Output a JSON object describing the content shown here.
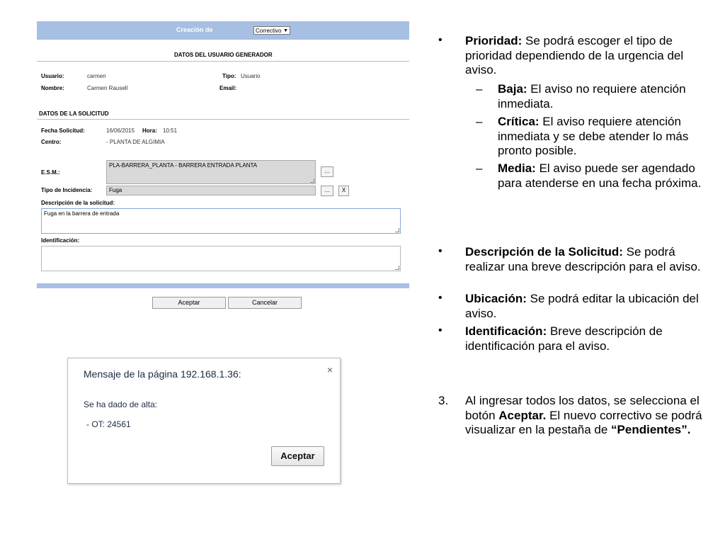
{
  "form": {
    "header": {
      "label": "Creación de",
      "select_value": "Correctivo"
    },
    "section_user_title": "DATOS DEL USUARIO GENERADOR",
    "usuario_label": "Usuario:",
    "usuario_value": "carmen",
    "tipo_label": "Tipo:",
    "tipo_value": "Usuario",
    "nombre_label": "Nombre:",
    "nombre_value": "Carmen Rausell",
    "email_label": "Email:",
    "section_request_title": "DATOS DE LA SOLICITUD",
    "fecha_label": "Fecha Solicitud:",
    "fecha_value": "16/06/2015",
    "hora_label": "Hora:",
    "hora_value": "10:51",
    "centro_label": "Centro:",
    "centro_value": "- PLANTA DE ALGIMIA",
    "esm_label": "E.S.M.:",
    "esm_value": "PLA-BARRERA_PLANTA - BARRERA ENTRADA PLANTA",
    "incidencia_label": "Tipo de Incidencia:",
    "incidencia_value": "Fuga",
    "descripcion_label": "Descripción de la solicitud:",
    "descripcion_value": "Fuga en la barrera de entrada",
    "identificacion_label": "Identificación:",
    "ellipsis_label": "...",
    "clear_label": "X",
    "accept_label": "Aceptar",
    "cancel_label": "Cancelar"
  },
  "dialog": {
    "title": "Mensaje de la página 192.168.1.36:",
    "close_label": "×",
    "message": "Se ha dado de alta:",
    "detail": "- OT: 24561",
    "ok_label": "Aceptar"
  },
  "text": {
    "bullet_char": "•",
    "dash_char": "–",
    "prioridad_term": "Prioridad:",
    "prioridad_desc": " Se podrá escoger el tipo de prioridad dependiendo de la urgencia del aviso.",
    "baja_term": "Baja:",
    "baja_desc": " El aviso no requiere atención inmediata.",
    "critica_term": "Crítica:",
    "critica_desc": " El aviso requiere atención inmediata y se debe atender lo más pronto posible.",
    "media_term": "Media:",
    "media_desc": " El aviso puede ser agendado para atenderse en una fecha próxima.",
    "descripcion_term": "Descripción de la Solicitud:",
    "descripcion_desc": " Se podrá realizar una breve descripción para el aviso.",
    "ubicacion_term": "Ubicación:",
    "ubicacion_desc": " Se podrá editar la ubicación del aviso.",
    "identificacion_term": "Identificación:",
    "identificacion_desc": " Breve descripción de identificación para el aviso.",
    "step_number": "3.",
    "step_part1": "Al ingresar todos los datos, se selecciona el botón ",
    "step_bold1": "Aceptar.",
    "step_part2": " El nuevo correctivo se podrá visualizar en la pestaña de ",
    "step_bold2": "“Pendientes”."
  }
}
